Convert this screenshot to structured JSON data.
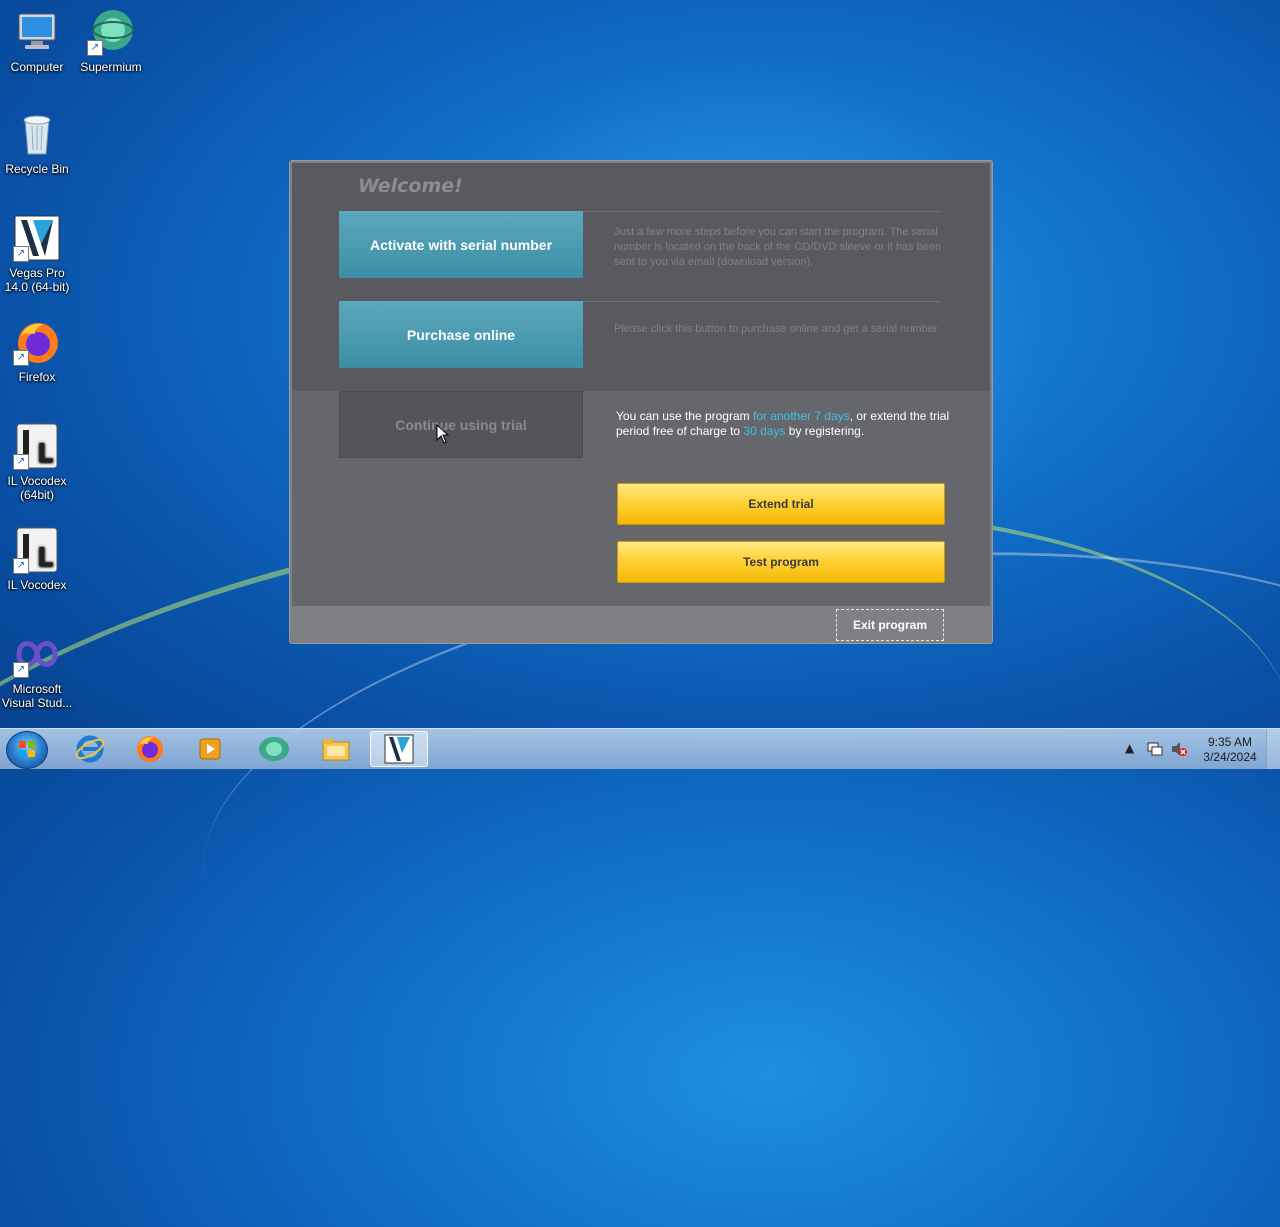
{
  "desktop": {
    "icons": [
      {
        "label": "Computer",
        "icon": "computer-icon"
      },
      {
        "label": "Supermium",
        "icon": "supermium-icon"
      },
      {
        "label": "Recycle Bin",
        "icon": "recycle-bin-icon"
      },
      {
        "label": "Vegas Pro 14.0 (64-bit)",
        "icon": "vegas-pro-icon"
      },
      {
        "label": "Firefox",
        "icon": "firefox-icon"
      },
      {
        "label": "IL Vocodex (64bit)",
        "icon": "il-vocodex-icon"
      },
      {
        "label": "IL Vocodex",
        "icon": "il-vocodex-icon"
      },
      {
        "label": "Microsoft Visual Stud...",
        "icon": "visual-studio-icon"
      }
    ]
  },
  "dialog": {
    "welcome": "Welcome!",
    "activate_label": "Activate with serial number",
    "activate_desc": "Just a few more steps before you can start the program. The serial number is located on the back of the CD/DVD sleeve or it has been sent to you via email (download version).",
    "purchase_label": "Purchase online",
    "purchase_desc": "Please click this button to purchase online and get a serial number.",
    "trial_label": "Continue using trial",
    "trial_desc": {
      "part1": "You can use the program ",
      "highlight1": "for another 7 days",
      "part2": ", or extend the trial period free of charge to ",
      "highlight2": "30 days",
      "part3": " by registering."
    },
    "extend_label": "Extend trial",
    "test_label": "Test program",
    "exit_label": "Exit program",
    "colors": {
      "accent_blue": "#4a9db4",
      "highlight": "#3fc0e4",
      "yellow": "#ffd23a"
    }
  },
  "taskbar": {
    "items": [
      "start-button",
      "internet-explorer-icon",
      "firefox-icon",
      "media-player-icon",
      "supermium-icon",
      "file-explorer-icon",
      "vegas-pro-icon"
    ],
    "active_item": "vegas-pro-icon",
    "time": "9:35 AM",
    "date": "3/24/2024"
  }
}
